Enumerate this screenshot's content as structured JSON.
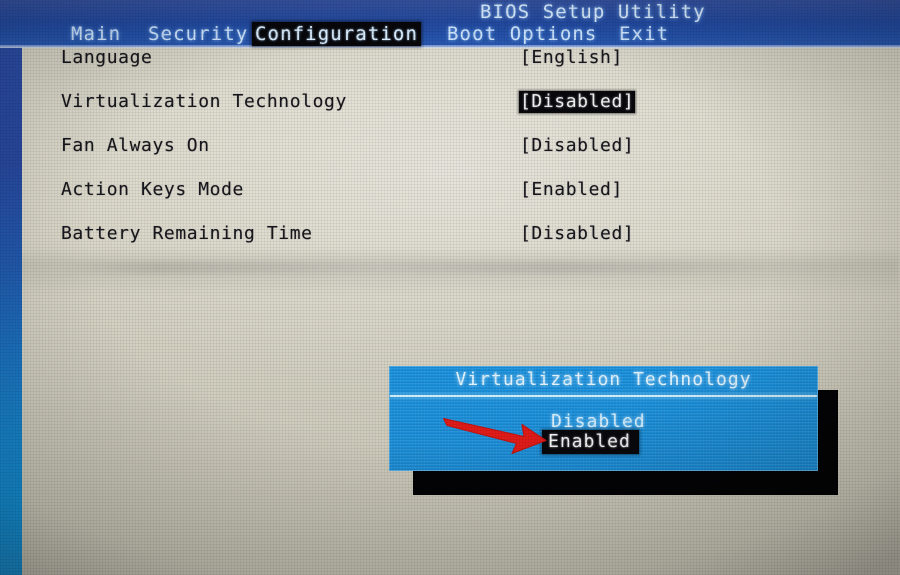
{
  "header": {
    "title": "BIOS Setup Utility",
    "tabs": [
      {
        "label": "Main",
        "active": false
      },
      {
        "label": "Security",
        "active": false
      },
      {
        "label": "Configuration",
        "active": true
      },
      {
        "label": "Boot Options",
        "active": false
      },
      {
        "label": "Exit",
        "active": false
      }
    ]
  },
  "settings": {
    "rows": [
      {
        "label": "Language",
        "value": "[English]",
        "selected": false
      },
      {
        "label": "Virtualization Technology",
        "value": "[Disabled]",
        "selected": true
      },
      {
        "label": "Fan Always On",
        "value": "[Disabled]",
        "selected": false
      },
      {
        "label": "Action Keys Mode",
        "value": "[Enabled]",
        "selected": false
      },
      {
        "label": "Battery Remaining Time",
        "value": "[Disabled]",
        "selected": false
      }
    ]
  },
  "dialog": {
    "title": "Virtualization Technology",
    "options": [
      {
        "label": "Disabled",
        "selected": false
      },
      {
        "label": "Enabled",
        "selected": true
      }
    ]
  },
  "annotation": {
    "arrow_color": "#e01b18",
    "points_to": "Enabled"
  },
  "colors": {
    "header_blue": "#24499f",
    "dialog_blue": "#1b90db",
    "screen_beige": "#d7d4c5",
    "highlight_black": "#08080c",
    "glow_text": "#d8ecff"
  }
}
